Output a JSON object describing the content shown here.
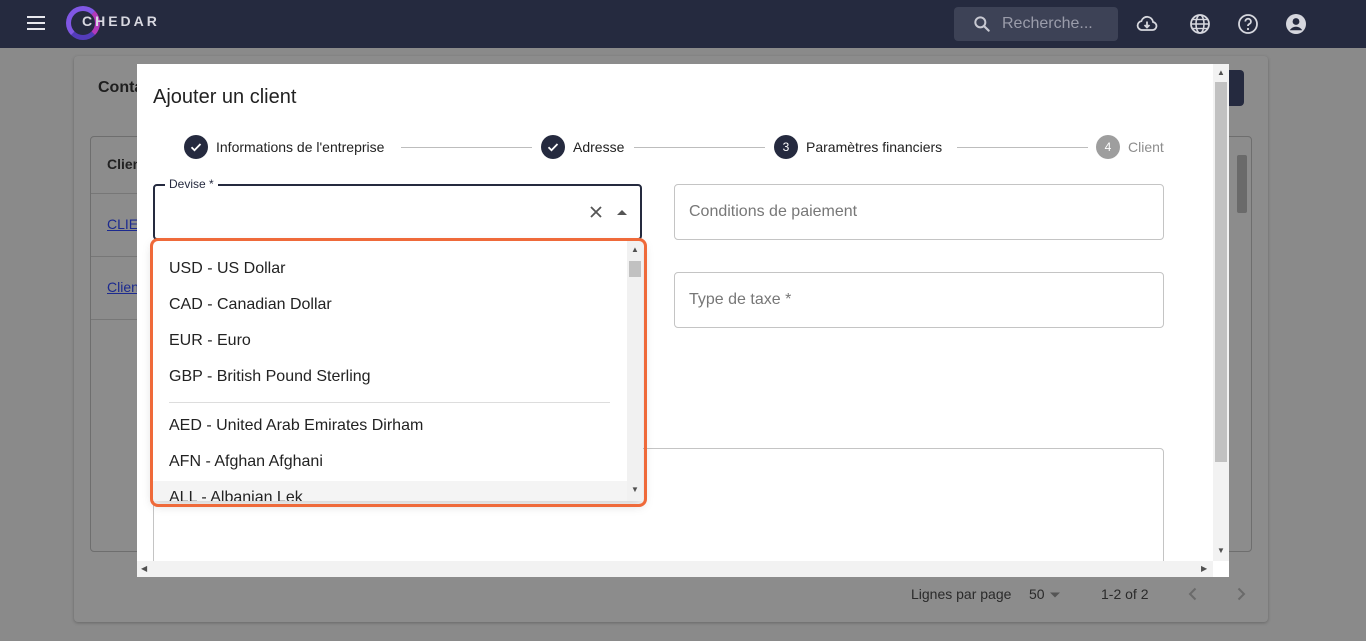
{
  "app": {
    "logo_text": "CHEDAR",
    "search_placeholder": "Recherche..."
  },
  "background": {
    "page_title_partial": "Conta",
    "table_header_partial": "Clien",
    "rows": [
      "CLIE",
      "Clien"
    ],
    "rows_per_page_label": "Lignes par page",
    "rows_per_page_value": "50",
    "pagination": "1-2 of 2"
  },
  "dialog": {
    "title": "Ajouter un client",
    "steps": [
      {
        "number": "1",
        "label": "Informations de l'entreprise",
        "state": "completed"
      },
      {
        "number": "2",
        "label": "Adresse",
        "state": "completed"
      },
      {
        "number": "3",
        "label": "Paramètres financiers",
        "state": "active"
      },
      {
        "number": "4",
        "label": "Client",
        "state": "inactive"
      }
    ],
    "fields": {
      "devise_label": "Devise *",
      "devise_value": "",
      "payment_terms_placeholder": "Conditions de paiement",
      "tax_type_placeholder": "Type de taxe *"
    },
    "currency_options": [
      "USD - US Dollar",
      "CAD - Canadian Dollar",
      "EUR - Euro",
      "GBP - British Pound Sterling",
      "AED - United Arab Emirates Dirham",
      "AFN - Afghan Afghani",
      "ALL - Albanian Lek"
    ]
  },
  "colors": {
    "appbar": "#252a3f",
    "accent": "#252a3f",
    "highlight": "#ef6a3a"
  }
}
